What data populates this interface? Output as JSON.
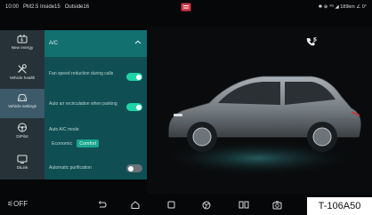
{
  "status": {
    "time": "10:00",
    "pm25": "PM2.5 Inside15",
    "outside": "Outside16",
    "right": "✱ ⊕ ⁴ᴳ ◢ 189km ∠ 0°"
  },
  "sidebar": {
    "items": [
      {
        "label": "New energy",
        "icon": "battery-icon"
      },
      {
        "label": "Vehicle health",
        "icon": "wrench-icon"
      },
      {
        "label": "Vehicle settings",
        "icon": "car-icon"
      },
      {
        "label": "DiPilot",
        "icon": "steering-wheel-icon"
      },
      {
        "label": "DiLink",
        "icon": "screen-icon"
      }
    ],
    "active_index": 2
  },
  "panel": {
    "title": "A/C",
    "rows": {
      "fan_speed": {
        "label": "Fan speed reduction during calls",
        "state": "on"
      },
      "recirculation": {
        "label": "Auto air recirculation when parking",
        "state": "on"
      },
      "ac_mode": {
        "label": "Auto A/C mode",
        "options": [
          "Economic",
          "Comfort"
        ],
        "selected": "Comfort"
      },
      "purification": {
        "label": "Automatic purification",
        "state": "off"
      }
    }
  },
  "bottom": {
    "off_label": "OFF",
    "code_label": "T-106A50"
  },
  "colors": {
    "accent": "#1ed4a6",
    "panel_bg": "#0f4f53",
    "panel_header": "#12706f",
    "sidebar_bg": "#263238",
    "sidebar_active": "#3d5a6a"
  }
}
